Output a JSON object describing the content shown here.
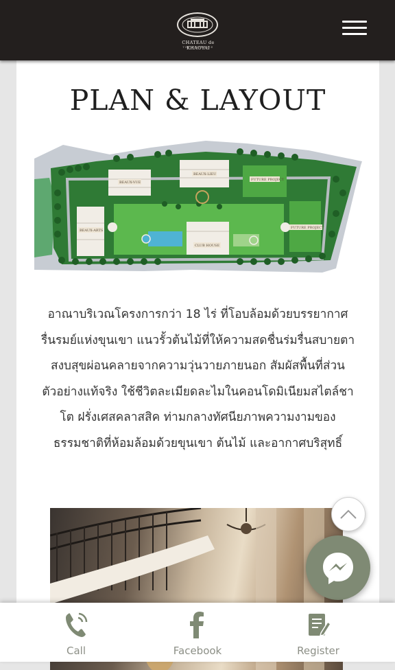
{
  "header": {
    "logo_name": "CHATEAU de KHAOYAI",
    "logo_subtitle": "THE RESIDENCE",
    "menu_icon": "hamburger-menu-icon"
  },
  "section": {
    "title": "PLAN & LAYOUT",
    "plan_labels": {
      "beau_vue": "BEAUX-VUE",
      "beau_lieu": "BEAUX-LIEU",
      "future1": "FUTURE PROJECT",
      "future2": "FUTURE PROJECT",
      "beau_arts": "BEAUX-ARTS",
      "club_house": "CLUB HOUSE"
    },
    "description_lines": [
      "อาณาบริเวณโครงการกว่า 18 ไร่ ที่โอบล้อมด้วยบรรยากาศ",
      "รื่นรมย์แห่งขุนเขา แนวรั้วต้นไม้ที่ให้ความสดชื่นร่มรื่นสบายตา",
      "สงบสุขผ่อนคลายจากความวุ่นวายภายนอก สัมผัสพื้นที่ส่วน",
      "ตัวอย่างแท้จริง ใช้ชีวิตละเมียดละไมในคอนโดมิเนียมสไตล์ชา",
      "โต ฝรั่งเศสคลาสสิค ท่ามกลางทัศนียภาพความงามของ",
      "ธรรมชาติที่ห้อมล้อมด้วยขุนเขา ต้นไม้ และอากาศบริสุทธิ์"
    ]
  },
  "floating": {
    "scroll_top_icon": "chevron-up-icon",
    "messenger_icon": "messenger-icon"
  },
  "bottom_bar": {
    "items": [
      {
        "label": "Call",
        "icon": "phone-icon"
      },
      {
        "label": "Facebook",
        "icon": "facebook-icon"
      },
      {
        "label": "Register",
        "icon": "register-form-icon"
      }
    ]
  },
  "colors": {
    "header_bg": "#231f1e",
    "accent_green": "#7f8a74",
    "label_gray": "#8c8f86"
  }
}
